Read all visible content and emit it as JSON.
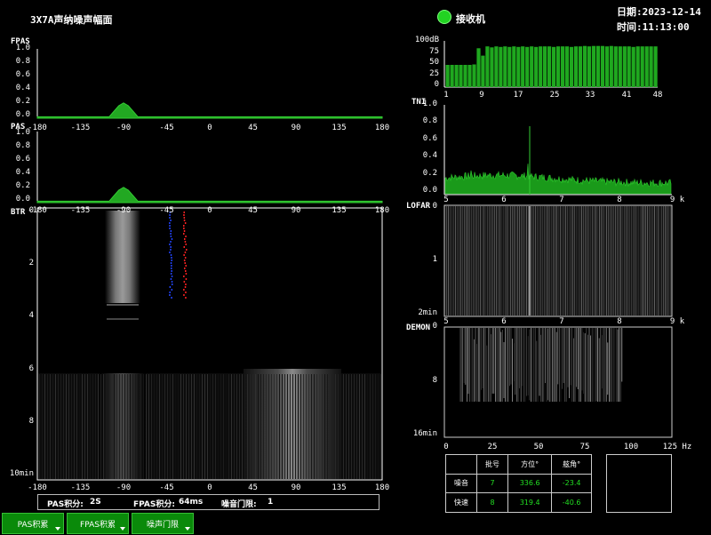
{
  "header": {
    "title": "3X7A声纳噪声幅面",
    "status_label": "接收机",
    "date": "日期:2023-12-14",
    "time": "时间:11:13:00"
  },
  "colors": {
    "accent": "#0a8a0a",
    "signal": "#22cc22",
    "bg": "#000000"
  },
  "panels": {
    "fpas": {
      "label": "FPAS",
      "yticks": [
        "1.0",
        "0.8",
        "0.6",
        "0.4",
        "0.2",
        "0.0"
      ]
    },
    "pas": {
      "label": "PAS",
      "yticks": [
        "1.0",
        "0.8",
        "0.6",
        "0.4",
        "0.2",
        "0.0"
      ]
    },
    "bearing_ticks": [
      "-180",
      "-135",
      "-90",
      "-45",
      "0",
      "45",
      "90",
      "135",
      "180"
    ],
    "btr": {
      "label": "BTR",
      "yticks": [
        "0",
        "2",
        "4",
        "6",
        "8",
        "10min"
      ]
    },
    "bars": {
      "yticks": [
        "100dB",
        "75",
        "50",
        "25",
        "0"
      ],
      "xticks": [
        "1",
        "9",
        "17",
        "25",
        "33",
        "41",
        "48"
      ]
    },
    "tni": {
      "label": "TNI",
      "yticks": [
        "1.0",
        "0.8",
        "0.6",
        "0.4",
        "0.2",
        "0.0"
      ],
      "xticks": [
        "5",
        "6",
        "7",
        "8",
        "9 k"
      ]
    },
    "lofar": {
      "label": "LOFAR",
      "yticks": [
        "0",
        "1",
        "2min"
      ],
      "xticks": [
        "5",
        "6",
        "7",
        "8",
        "9 k"
      ]
    },
    "demon": {
      "label": "DEMON",
      "yticks": [
        "0",
        "8",
        "16min"
      ],
      "xticks": [
        "0",
        "25",
        "50",
        "75",
        "100",
        "125 Hz"
      ]
    }
  },
  "infobar": {
    "pas_label": "PAS积分:",
    "pas_value": "2S",
    "fpas_label": "FPAS积分:",
    "fpas_value": "64ms",
    "noise_label": "噪音门限:",
    "noise_value": "1"
  },
  "target_table": {
    "headers": [
      "",
      "批号",
      "方位°",
      "舷角°"
    ],
    "rows": [
      {
        "name": "噪音",
        "batch": "7",
        "bearing": "336.6",
        "angle": "-23.4"
      },
      {
        "name": "快速",
        "batch": "8",
        "bearing": "319.4",
        "angle": "-40.6"
      }
    ]
  },
  "buttons": {
    "pas_accum": "PAS积累",
    "fpas_accum": "FPAS积累",
    "noise_gate": "噪声门限"
  },
  "chart_data": [
    {
      "type": "area",
      "title": "FPAS",
      "xlabel": "",
      "ylabel": "",
      "xlim": [
        -180,
        180
      ],
      "ylim": [
        0,
        1
      ],
      "x": [
        -180,
        -120,
        -105,
        -100,
        -95,
        -90,
        -85,
        -80,
        -75,
        -60,
        180
      ],
      "values": [
        0.02,
        0.02,
        0.02,
        0.1,
        0.18,
        0.22,
        0.18,
        0.1,
        0.02,
        0.02,
        0.02
      ]
    },
    {
      "type": "area",
      "title": "PAS",
      "xlabel": "",
      "ylabel": "",
      "xlim": [
        -180,
        180
      ],
      "ylim": [
        0,
        1
      ],
      "x": [
        -180,
        -120,
        -105,
        -100,
        -95,
        -90,
        -85,
        -80,
        -75,
        -60,
        180
      ],
      "values": [
        0.02,
        0.02,
        0.02,
        0.1,
        0.18,
        0.22,
        0.18,
        0.1,
        0.02,
        0.02,
        0.02
      ]
    },
    {
      "type": "bar",
      "title": "",
      "ylim": [
        0,
        100
      ],
      "categories_start": 1,
      "categories_end": 48,
      "values": [
        48,
        48,
        48,
        48,
        48,
        48,
        49,
        84,
        68,
        88,
        86,
        88,
        87,
        88,
        87,
        88,
        87,
        88,
        87,
        88,
        87,
        88,
        88,
        88,
        87,
        88,
        88,
        88,
        87,
        88,
        88,
        89,
        88,
        89,
        89,
        89,
        88,
        89,
        88,
        88,
        88,
        88,
        87,
        88,
        88,
        88,
        88,
        88
      ]
    },
    {
      "type": "area",
      "title": "TNI",
      "xlim": [
        5,
        9
      ],
      "ylim": [
        0,
        1
      ],
      "peaks": [
        {
          "x": 6.45,
          "y": 0.77
        },
        {
          "x": 5.45,
          "y": 0.27
        },
        {
          "x": 6.4,
          "y": 0.35
        }
      ]
    }
  ]
}
